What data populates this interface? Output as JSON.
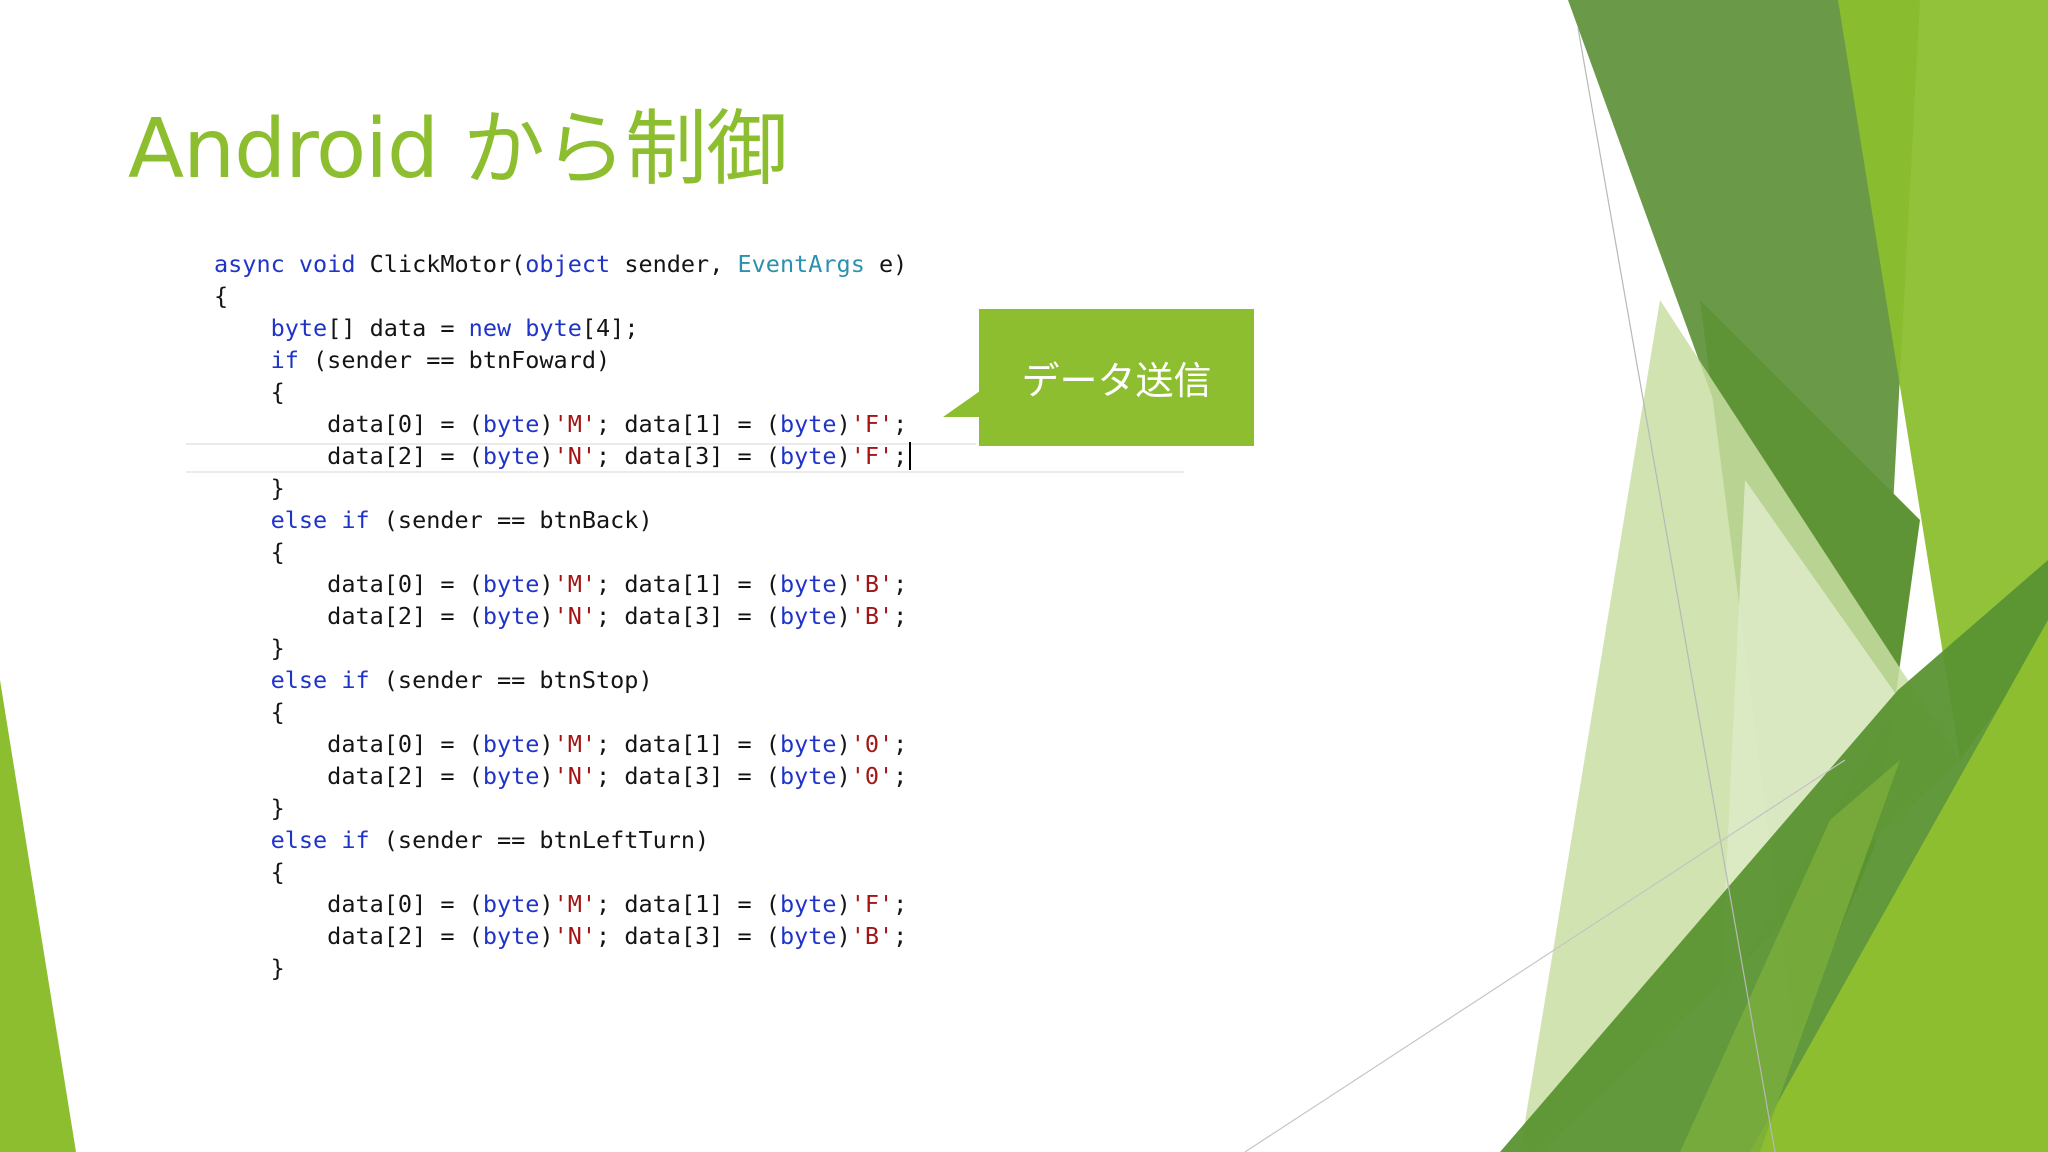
{
  "slide": {
    "title": "Android から制御",
    "callout": "データ送信",
    "theme_colors": {
      "accent": "#8cbe2f",
      "dark_green": "#5a9432",
      "muted_green": "#6a9a48",
      "light_green": "#c9dea2",
      "code_keyword": "#2034c8",
      "code_type": "#2b91af",
      "code_string": "#a31515"
    }
  },
  "code": {
    "l1": {
      "a": "async",
      "b": " ",
      "c": "void",
      "d": " ClickMotor(",
      "e": "object",
      "f": " sender, ",
      "g": "EventArgs",
      "h": " e)"
    },
    "l2": {
      "a": "{"
    },
    "l3": {
      "a": "    ",
      "b": "byte",
      "c": "[] data = ",
      "d": "new",
      "e": " ",
      "f": "byte",
      "g": "[4];"
    },
    "l4": {
      "a": "    ",
      "b": "if",
      "c": " (sender == btnFoward)"
    },
    "l5": {
      "a": "    {"
    },
    "l6": {
      "a": "        data[0] = (",
      "b": "byte",
      "c": ")",
      "d": "'M'",
      "e": "; data[1] = (",
      "f": "byte",
      "g": ")",
      "h": "'F'",
      "i": ";"
    },
    "l7": {
      "a": "        data[2] = (",
      "b": "byte",
      "c": ")",
      "d": "'N'",
      "e": "; data[3] = (",
      "f": "byte",
      "g": ")",
      "h": "'F'",
      "i": ";"
    },
    "l8": {
      "a": "    }"
    },
    "l9": {
      "a": "    ",
      "b": "else",
      "c": " ",
      "d": "if",
      "e": " (sender == btnBack)"
    },
    "l10": {
      "a": "    {"
    },
    "l11": {
      "a": "        data[0] = (",
      "b": "byte",
      "c": ")",
      "d": "'M'",
      "e": "; data[1] = (",
      "f": "byte",
      "g": ")",
      "h": "'B'",
      "i": ";"
    },
    "l12": {
      "a": "        data[2] = (",
      "b": "byte",
      "c": ")",
      "d": "'N'",
      "e": "; data[3] = (",
      "f": "byte",
      "g": ")",
      "h": "'B'",
      "i": ";"
    },
    "l13": {
      "a": "    }"
    },
    "l14": {
      "a": "    ",
      "b": "else",
      "c": " ",
      "d": "if",
      "e": " (sender == btnStop)"
    },
    "l15": {
      "a": "    {"
    },
    "l16": {
      "a": "        data[0] = (",
      "b": "byte",
      "c": ")",
      "d": "'M'",
      "e": "; data[1] = (",
      "f": "byte",
      "g": ")",
      "h": "'0'",
      "i": ";"
    },
    "l17": {
      "a": "        data[2] = (",
      "b": "byte",
      "c": ")",
      "d": "'N'",
      "e": "; data[3] = (",
      "f": "byte",
      "g": ")",
      "h": "'0'",
      "i": ";"
    },
    "l18": {
      "a": "    }"
    },
    "l19": {
      "a": "    ",
      "b": "else",
      "c": " ",
      "d": "if",
      "e": " (sender == btnLeftTurn)"
    },
    "l20": {
      "a": "    {"
    },
    "l21": {
      "a": "        data[0] = (",
      "b": "byte",
      "c": ")",
      "d": "'M'",
      "e": "; data[1] = (",
      "f": "byte",
      "g": ")",
      "h": "'F'",
      "i": ";"
    },
    "l22": {
      "a": "        data[2] = (",
      "b": "byte",
      "c": ")",
      "d": "'N'",
      "e": "; data[3] = (",
      "f": "byte",
      "g": ")",
      "h": "'B'",
      "i": ";"
    },
    "l23": {
      "a": "    }"
    }
  }
}
